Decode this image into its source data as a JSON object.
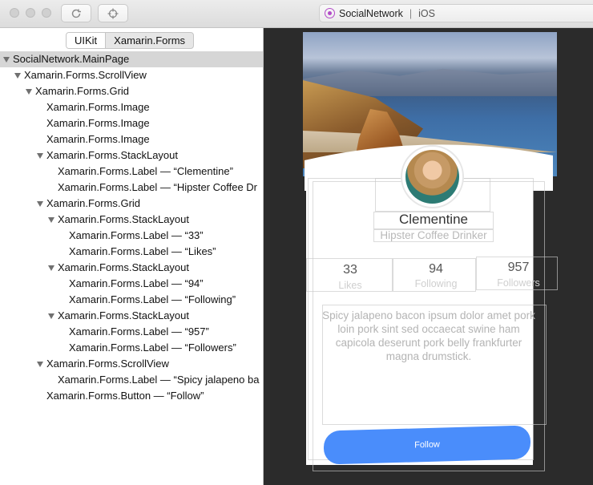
{
  "window": {
    "app_icon": "app-circle-icon",
    "app_name": "SocialNetwork",
    "separator": "|",
    "platform": "iOS",
    "toolbar_icons": [
      "refresh-icon",
      "crosshair-icon"
    ]
  },
  "segmented": {
    "items": [
      "UIKit",
      "Xamarin.Forms"
    ],
    "selected": "UIKit"
  },
  "tree": [
    {
      "label": "SocialNetwork.MainPage",
      "level": 0,
      "expanded": true,
      "selected": true
    },
    {
      "label": "Xamarin.Forms.ScrollView",
      "level": 1,
      "expanded": true
    },
    {
      "label": "Xamarin.Forms.Grid",
      "level": 2,
      "expanded": true
    },
    {
      "label": "Xamarin.Forms.Image",
      "level": 3
    },
    {
      "label": "Xamarin.Forms.Image",
      "level": 3
    },
    {
      "label": "Xamarin.Forms.Image",
      "level": 3
    },
    {
      "label": "Xamarin.Forms.StackLayout",
      "level": 3,
      "expanded": true
    },
    {
      "label": "Xamarin.Forms.Label — “Clementine”",
      "level": 4
    },
    {
      "label": "Xamarin.Forms.Label — “Hipster Coffee Dr",
      "level": 4
    },
    {
      "label": "Xamarin.Forms.Grid",
      "level": 3,
      "expanded": true
    },
    {
      "label": "Xamarin.Forms.StackLayout",
      "level": 4,
      "expanded": true
    },
    {
      "label": "Xamarin.Forms.Label — “33”",
      "level": 5
    },
    {
      "label": "Xamarin.Forms.Label — “Likes”",
      "level": 5
    },
    {
      "label": "Xamarin.Forms.StackLayout",
      "level": 4,
      "expanded": true
    },
    {
      "label": "Xamarin.Forms.Label — “94”",
      "level": 5
    },
    {
      "label": "Xamarin.Forms.Label — “Following”",
      "level": 5
    },
    {
      "label": "Xamarin.Forms.StackLayout",
      "level": 4,
      "expanded": true
    },
    {
      "label": "Xamarin.Forms.Label — “957”",
      "level": 5
    },
    {
      "label": "Xamarin.Forms.Label — “Followers”",
      "level": 5
    },
    {
      "label": "Xamarin.Forms.ScrollView",
      "level": 3,
      "expanded": true
    },
    {
      "label": "Xamarin.Forms.Label — “Spicy jalapeno ba",
      "level": 4
    },
    {
      "label": "Xamarin.Forms.Button — “Follow”",
      "level": 3
    }
  ],
  "preview": {
    "name": "Clementine",
    "subtitle": "Hipster Coffee Drinker",
    "stats": [
      {
        "value": "33",
        "label": "Likes"
      },
      {
        "value": "94",
        "label": "Following"
      },
      {
        "value": "957",
        "label": "Followers"
      }
    ],
    "description": "Spicy jalapeno bacon ipsum dolor amet pork loin pork sint sed occaecat swine ham capicola deserunt pork belly frankfurter magna drumstick.",
    "button": "Follow"
  },
  "colors": {
    "accent": "#4a8dfb",
    "app_icon": "#b24bc8",
    "selection": "#d6d6d6",
    "canvas": "#2b2b2b"
  }
}
